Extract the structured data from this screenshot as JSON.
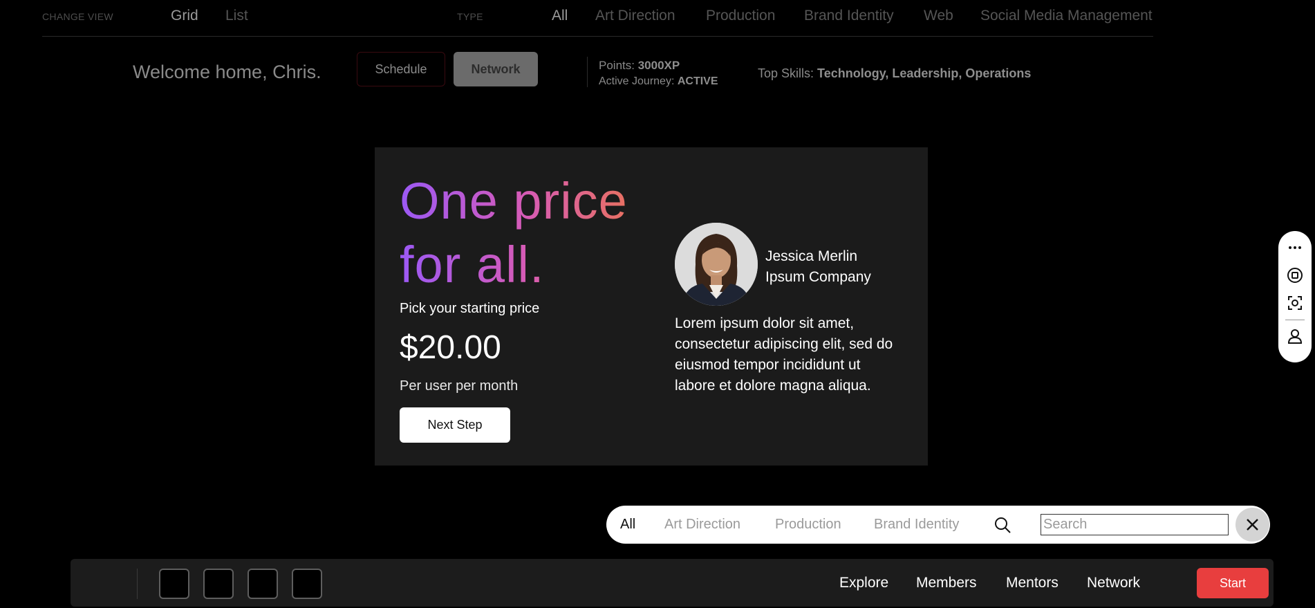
{
  "topbar": {
    "change_view_label": "CHANGE VIEW",
    "views": [
      "Grid",
      "List"
    ],
    "type_label": "TYPE",
    "types": [
      "All",
      "Art Direction",
      "Production",
      "Brand Identity",
      "Web",
      "Social Media Management"
    ]
  },
  "header": {
    "welcome": "Welcome home, Chris.",
    "schedule_label": "Schedule",
    "network_label": "Network",
    "points_label": "Points:",
    "points_value": "3000XP",
    "journey_label": "Active Journey:",
    "journey_value": "ACTIVE",
    "skills_label": "Top Skills:",
    "skills_value": "Technology, Leadership, Operations"
  },
  "card": {
    "headline": "One price for all.",
    "pick_label": "Pick your starting price",
    "price": "$20.00",
    "per_label": "Per user per month",
    "next_label": "Next Step",
    "person_name": "Jessica Merlin",
    "person_company": "Ipsum Company",
    "quote": "Lorem ipsum dolor sit amet, consectetur adipiscing elit, sed do eiusmod tempor incididunt ut labore et dolore magna aliqua."
  },
  "sidetools": {
    "icons": [
      "more-icon",
      "stop-icon",
      "focus-icon",
      "user-icon"
    ]
  },
  "filterpill": {
    "options": [
      "All",
      "Art Direction",
      "Production",
      "Brand Identity"
    ],
    "search_placeholder": "Search"
  },
  "dock": {
    "nav": [
      "Explore",
      "Members",
      "Mentors",
      "Network"
    ],
    "start_label": "Start"
  },
  "colors": {
    "accent_red": "#e83e3e",
    "gradient_start": "#9b59f5",
    "gradient_end": "#f07a3a",
    "card_bg": "#1b1b1b"
  }
}
